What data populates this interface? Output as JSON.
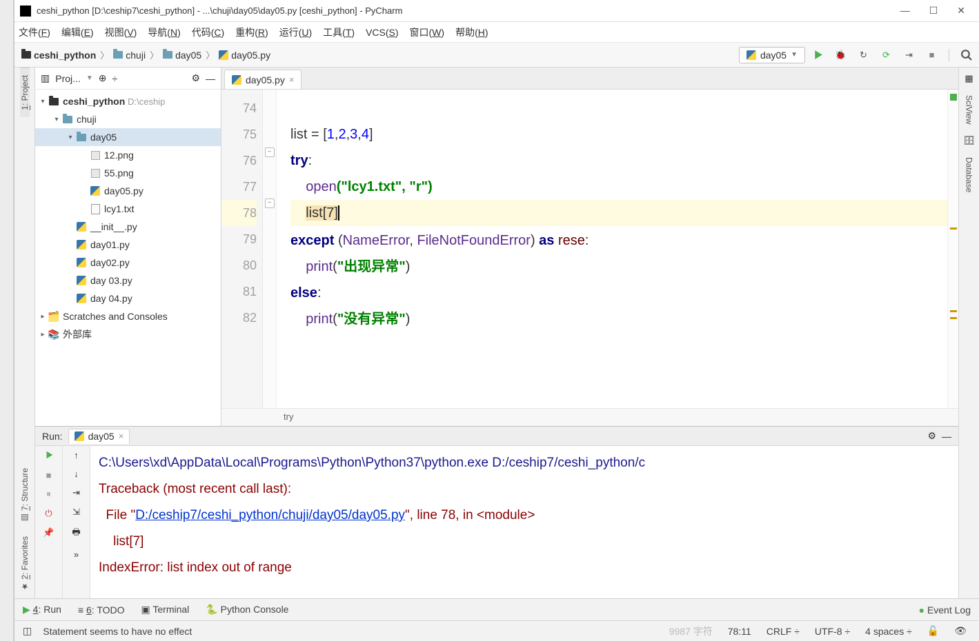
{
  "titlebar": {
    "title": "ceshi_python [D:\\ceship7\\ceshi_python] - ...\\chuji\\day05\\day05.py [ceshi_python] - PyCharm"
  },
  "menubar": {
    "items": [
      {
        "pre": "文件(",
        "u": "F",
        "post": ")"
      },
      {
        "pre": "编辑(",
        "u": "E",
        "post": ")"
      },
      {
        "pre": "视图(",
        "u": "V",
        "post": ")"
      },
      {
        "pre": "导航(",
        "u": "N",
        "post": ")"
      },
      {
        "pre": "代码(",
        "u": "C",
        "post": ")"
      },
      {
        "pre": "重构(",
        "u": "R",
        "post": ")"
      },
      {
        "pre": "运行(",
        "u": "U",
        "post": ")"
      },
      {
        "pre": "工具(",
        "u": "T",
        "post": ")"
      },
      {
        "pre": "VCS(",
        "u": "S",
        "post": ")"
      },
      {
        "pre": "窗口(",
        "u": "W",
        "post": ")"
      },
      {
        "pre": "帮助(",
        "u": "H",
        "post": ")"
      }
    ]
  },
  "breadcrumb": {
    "items": [
      "ceshi_python",
      "chuji",
      "day05",
      "day05.py"
    ]
  },
  "runconfig": {
    "label": "day05"
  },
  "left_strip": {
    "project_u": "1",
    "project_label": ": Project",
    "structure_u": "7",
    "structure_label": ": Structure",
    "favorites_u": "2",
    "favorites_label": ": Favorites"
  },
  "right_strip": {
    "sciview": "SciView",
    "database": "Database"
  },
  "project_panel": {
    "header": "Proj..."
  },
  "tree": {
    "root": {
      "name": "ceshi_python",
      "path": "D:\\ceship"
    },
    "chuji": "chuji",
    "day05dir": "day05",
    "files": [
      "12.png",
      "55.png",
      "day05.py",
      "lcy1.txt"
    ],
    "siblings": [
      "__init__.py",
      "day01.py",
      "day02.py",
      "day 03.py",
      "day 04.py"
    ],
    "scratches": "Scratches and Consoles",
    "external": "外部库"
  },
  "editor": {
    "tab": "day05.py",
    "lines": [
      "74",
      "75",
      "76",
      "77",
      "78",
      "79",
      "80",
      "81",
      "82"
    ],
    "code": {
      "l75_list": "list = [",
      "l75_nums": [
        "1",
        "2",
        "3",
        "4"
      ],
      "l76_try": "try",
      "l77_open": "open",
      "l77_args": "(\"lcy1.txt\", \"r\")",
      "l78_list": "list",
      "l78_idx": "[7]",
      "l79_except": "except ",
      "l79_open": "(",
      "l79_ne": "NameError",
      "l79_comma": ", ",
      "l79_fe": "FileNotFoundError",
      "l79_close": ") ",
      "l79_as": "as ",
      "l79_rese": "rese",
      "l80_print": "print",
      "l80_open": "(",
      "l80_str": "\"出现异常\"",
      "l80_close": ")",
      "l81_else": "else",
      "l82_print": "print",
      "l82_open": "(",
      "l82_str": "\"没有异常\"",
      "l82_close": ")"
    },
    "context": "try"
  },
  "run": {
    "header": "Run:",
    "tab": "day05",
    "line1": "C:\\Users\\xd\\AppData\\Local\\Programs\\Python\\Python37\\python.exe D:/ceship7/ceshi_python/c",
    "line2": "Traceback (most recent call last):",
    "line3_a": "  File \"",
    "line3_link": "D:/ceship7/ceshi_python/chuji/day05/day05.py",
    "line3_b": "\", line 78, in <module>",
    "line4": "    list[7]",
    "line5": "IndexError: list index out of range"
  },
  "bottom_tools": {
    "run_u": "4",
    "run": ": Run",
    "todo_u": "6",
    "todo": ": TODO",
    "terminal": "Terminal",
    "python_console": "Python Console",
    "event_log": "Event Log"
  },
  "statusbar": {
    "msg": "Statement seems to have no effect",
    "ghost": "9987 字符",
    "pos": "78:11",
    "crlf": "CRLF",
    "sep": "÷",
    "enc": "UTF-8",
    "sep2": "÷",
    "indent": "4 spaces",
    "sep3": "÷"
  }
}
